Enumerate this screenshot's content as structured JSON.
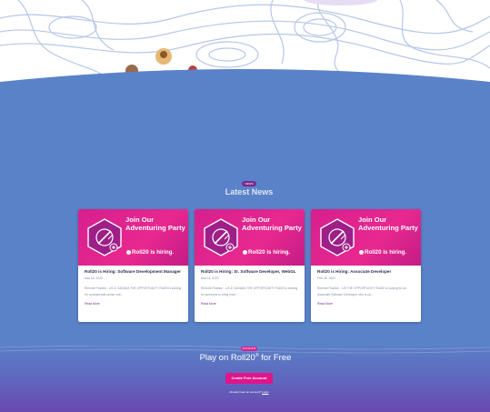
{
  "latest_news": {
    "badge": "NEWS",
    "title": "Latest News",
    "cards": [
      {
        "banner_heading": "Join Our Adventuring Party",
        "banner_brand": "Roll20",
        "banner_hiring": "is hiring.",
        "title": "Roll20 is Hiring: Software Development Manager",
        "date": "Mar 16, 2022",
        "excerpt": "Remote Position - US & CANADA THE OPPORTUNITY Roll20 is looking for a passionate senior soft...",
        "read_more": "Read More"
      },
      {
        "banner_heading": "Join Our Adventuring Party",
        "banner_brand": "Roll20",
        "banner_hiring": "is hiring.",
        "title": "Roll20 is Hiring: Sr. Software Developer, WebGL",
        "date": "Mar 16, 2022",
        "excerpt": "Remote Position - US & CANADA THE OPPORTUNITY Roll20 is looking for someone to bring excit...",
        "read_more": "Read More"
      },
      {
        "banner_heading": "Join Our Adventuring Party",
        "banner_brand": "Roll20",
        "banner_hiring": "is hiring.",
        "title": "Roll20 is Hiring: Associate Developer",
        "date": "Feb 28, 2022",
        "excerpt": "Remote Position - US THE OPPORTUNITY Roll20 is looking for an Associate Software Developer who is ca...",
        "read_more": "Read More"
      }
    ]
  },
  "cta": {
    "badge": "ACCOUNT",
    "title": "Play on Roll20",
    "title_sup": "®",
    "title_suffix": "for Free",
    "button_label": "Create Free Account",
    "login_prefix": "Already have an account?",
    "login_link": "Login"
  },
  "colors": {
    "page_blue": "#5a82c8",
    "brand_pink": "#e0158a",
    "badge_purple": "#7a2a8e"
  },
  "icons": [
    "hexagon-sword-icon",
    "roll20-logo-icon"
  ]
}
